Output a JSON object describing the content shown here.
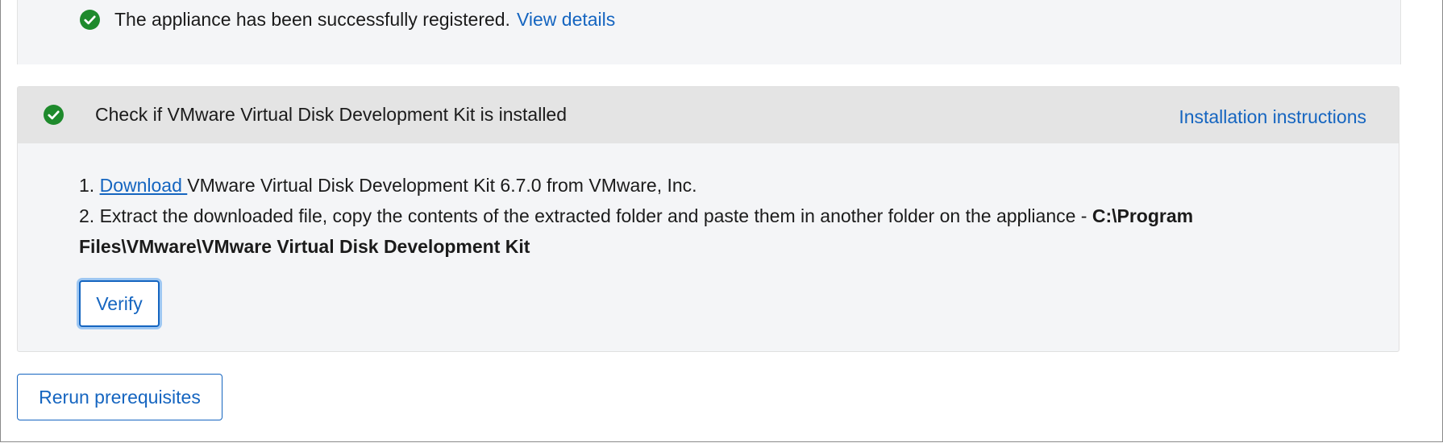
{
  "registration": {
    "message": "The appliance has been successfully registered.",
    "details_link": "View details",
    "status_icon": "check-circle-icon",
    "status_color": "#1e8a2c"
  },
  "step": {
    "title": "Check if VMware Virtual Disk Development Kit is installed",
    "status_icon": "check-circle-icon",
    "instructions_link": "Installation instructions",
    "line1_prefix": "1. ",
    "download_link": "Download ",
    "line1_suffix": "VMware Virtual Disk Development Kit 6.7.0 from VMware, Inc.",
    "line2_text": "2. Extract the downloaded file, copy the contents of the extracted folder and paste them in another folder on the appliance - ",
    "line2_path_part1": "C:\\Program",
    "line2_path_part2": "Files\\VMware\\VMware Virtual Disk Development Kit",
    "verify_label": "Verify"
  },
  "actions": {
    "rerun_label": "Rerun prerequisites"
  },
  "colors": {
    "accent": "#1565c0",
    "panel_bg": "#f4f5f7",
    "header_bg": "#e4e4e4"
  }
}
